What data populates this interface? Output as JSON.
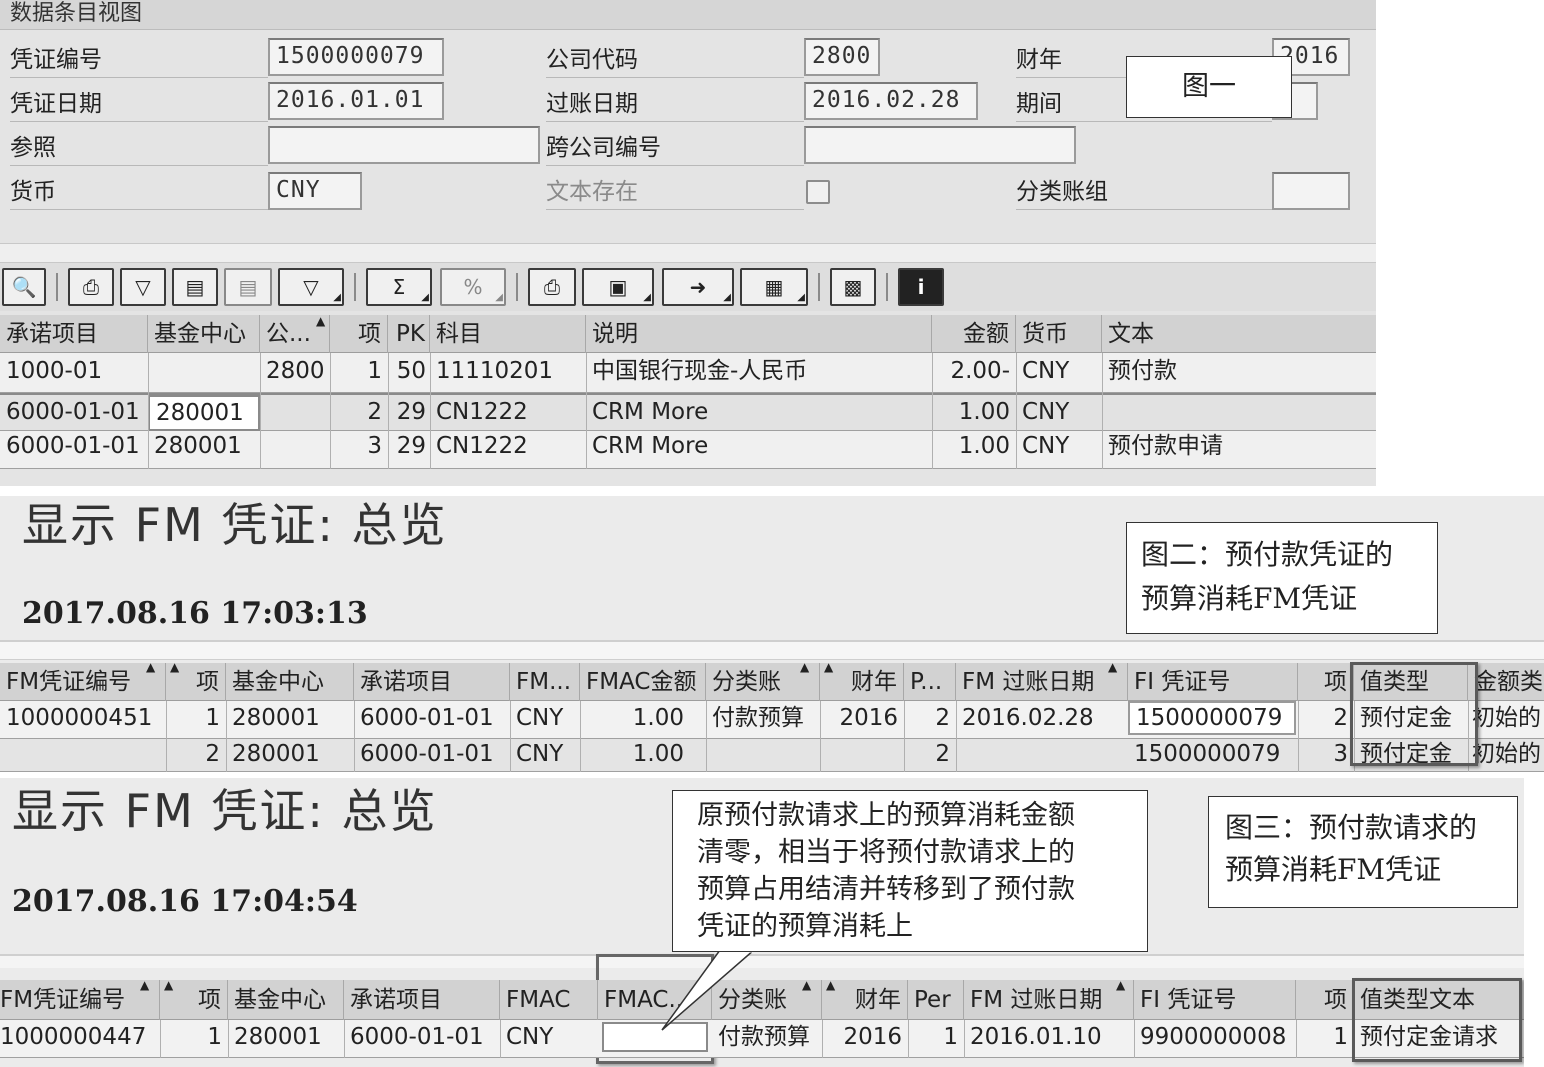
{
  "panel1": {
    "title": "数据条目视图",
    "callout": "图一",
    "header": {
      "doc_no_label": "凭证编号",
      "doc_no": "1500000079",
      "company_label": "公司代码",
      "company": "2800",
      "fiscal_year_label": "财年",
      "fiscal_year": "2016",
      "doc_date_label": "凭证日期",
      "doc_date": "2016.01.01",
      "posting_date_label": "过账日期",
      "posting_date": "2016.02.28",
      "period_label": "期间",
      "period": "",
      "ref_label": "参照",
      "ref": "",
      "cross_company_label": "跨公司编号",
      "cross_company": "",
      "currency_label": "货币",
      "currency": "CNY",
      "text_exists_label": "文本存在",
      "ledger_group_label": "分类账组",
      "ledger_group": ""
    },
    "toolbar_icons": [
      "detail-icon",
      "print-icon",
      "filter-icon",
      "find-icon",
      "find-next-icon",
      "set-filter-icon",
      "sum-icon",
      "subtotal-icon",
      "print-preview-icon",
      "export-icon",
      "local-file-icon",
      "change-layout-icon",
      "chart-icon",
      "info-icon"
    ],
    "columns": [
      "承诺项目",
      "基金中心",
      "公...",
      "项",
      "PK",
      "科目",
      "说明",
      "金额",
      "货币",
      "文本"
    ],
    "rows": [
      [
        "1000-01",
        "",
        "2800",
        "1",
        "50",
        "11110201",
        "中国银行现金-人民币",
        "2.00-",
        "CNY",
        "预付款"
      ],
      [
        "6000-01-01",
        "280001",
        "",
        "2",
        "29",
        "CN1222",
        "CRM More",
        "1.00",
        "CNY",
        ""
      ],
      [
        "6000-01-01",
        "280001",
        "",
        "3",
        "29",
        "CN1222",
        "CRM More",
        "1.00",
        "CNY",
        "预付款申请"
      ]
    ]
  },
  "panel2": {
    "title": "显示  FM 凭证: 总览",
    "timestamp": "2017.08.16 17:03:13",
    "callout": [
      "图二：预付款凭证的",
      "预算消耗FM凭证"
    ],
    "columns": [
      "FM凭证编号",
      "项",
      "基金中心",
      "承诺项目",
      "FM...",
      "FMAC金额",
      "分类账",
      "财年",
      "P...",
      "FM 过账日期",
      "FI 凭证号",
      "项",
      "值类型",
      "金额类"
    ],
    "rows": [
      [
        "1000000451",
        "1",
        "280001",
        "6000-01-01",
        "CNY",
        "1.00",
        "付款预算",
        "2016",
        "2",
        "2016.02.28",
        "1500000079",
        "2",
        "预付定金",
        "初始的"
      ],
      [
        "",
        "2",
        "280001",
        "6000-01-01",
        "CNY",
        "1.00",
        "",
        "",
        "2",
        "",
        "1500000079",
        "3",
        "预付定金",
        "初始的"
      ]
    ]
  },
  "panel3": {
    "title": "显示  FM 凭证: 总览",
    "timestamp": "2017.08.16 17:04:54",
    "speech_callout": [
      "原预付款请求上的预算消耗金额",
      "清零，相当于将预付款请求上的",
      "预算占用结清并转移到了预付款",
      "凭证的预算消耗上"
    ],
    "callout": [
      "图三：预付款请求的",
      "预算消耗FM凭证"
    ],
    "columns": [
      "FM凭证编号",
      "项",
      "基金中心",
      "承诺项目",
      "FMAC",
      "FMAC...",
      "分类账",
      "财年",
      "Per",
      "FM 过账日期",
      "FI 凭证号",
      "项",
      "值类型文本"
    ],
    "rows": [
      [
        "1000000447",
        "1",
        "280001",
        "6000-01-01",
        "CNY",
        "",
        "付款预算",
        "2016",
        "1",
        "2016.01.10",
        "9900000008",
        "1",
        "预付定金请求"
      ]
    ]
  }
}
